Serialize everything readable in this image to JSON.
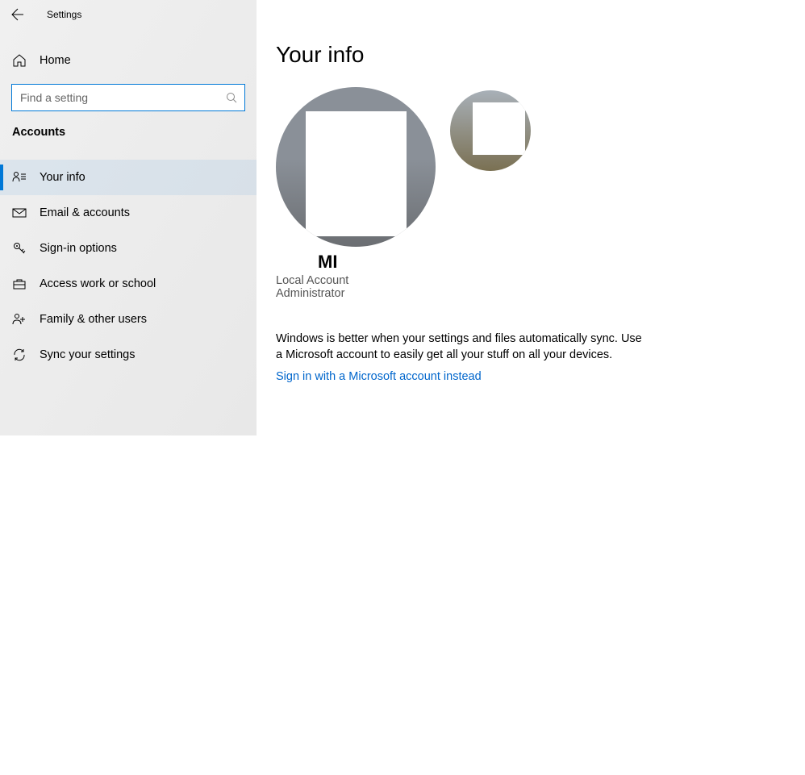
{
  "app": {
    "title": "Settings"
  },
  "sidebar": {
    "home_label": "Home",
    "search_placeholder": "Find a setting",
    "section_header": "Accounts",
    "items": [
      {
        "label": "Your info",
        "icon": "user-detail-icon",
        "active": true
      },
      {
        "label": "Email & accounts",
        "icon": "mail-icon",
        "active": false
      },
      {
        "label": "Sign-in options",
        "icon": "key-icon",
        "active": false
      },
      {
        "label": "Access work or school",
        "icon": "briefcase-icon",
        "active": false
      },
      {
        "label": "Family & other users",
        "icon": "people-icon",
        "active": false
      },
      {
        "label": "Sync your settings",
        "icon": "sync-icon",
        "active": false
      }
    ]
  },
  "main": {
    "page_title": "Your info",
    "user_name": "MI",
    "account_type": "Local Account",
    "role": "Administrator",
    "description": "Windows is better when your settings and files automatically sync. Use a Microsoft account to easily get all your stuff on all your devices.",
    "signin_link": "Sign in with a Microsoft account instead"
  }
}
